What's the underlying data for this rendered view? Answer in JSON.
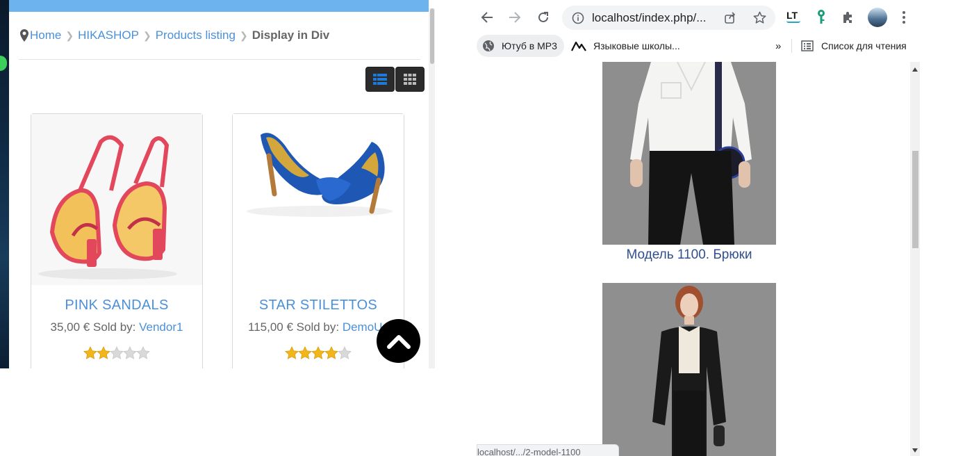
{
  "shop": {
    "breadcrumb": [
      {
        "label": "Home"
      },
      {
        "label": "HIKASHOP"
      },
      {
        "label": "Products listing"
      }
    ],
    "breadcrumb_current": "Display in Div",
    "view_modes": [
      "list-view-icon",
      "grid-view-icon"
    ],
    "products": [
      {
        "name": "PINK SANDALS",
        "price": "35,00 € Sold by: ",
        "vendor": "Vendor1",
        "rating": 2,
        "max_rating": 5
      },
      {
        "name": "STAR STILETTOS",
        "price": "115,00 € Sold by: ",
        "vendor": "DemoUs",
        "rating": 4,
        "max_rating": 5
      }
    ],
    "colors": {
      "link": "#4a90d9",
      "top_bar": "#6db4ef",
      "star": "#f2b619"
    }
  },
  "browser": {
    "url": "localhost/index.php/...",
    "bookmarks": [
      {
        "label": "Ютуб в MP3"
      },
      {
        "label": "Языковые школы..."
      }
    ],
    "overflow_label": "»",
    "reading_list_label": "Список для чтения",
    "product_caption": "Модель 1100. Брюки",
    "status_url": "localhost/.../2-model-1100",
    "caption_color": "#2f4f8f"
  }
}
